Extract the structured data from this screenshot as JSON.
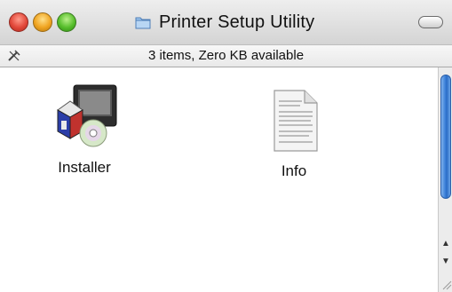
{
  "window": {
    "title": "Printer Setup Utility",
    "status_text": "3 items, Zero KB available"
  },
  "items": [
    {
      "label": "Installer",
      "icon": "installer-icon"
    },
    {
      "label": "Info",
      "icon": "document-icon"
    }
  ],
  "icons": {
    "title": "folder-icon",
    "status": "no-write-pencil-icon",
    "scroll_up": "▲",
    "scroll_down": "▼"
  },
  "colors": {
    "close": "#e2483a",
    "minimize": "#f0a421",
    "zoom": "#57be2c",
    "scroll_thumb": "#3a7fd8"
  }
}
